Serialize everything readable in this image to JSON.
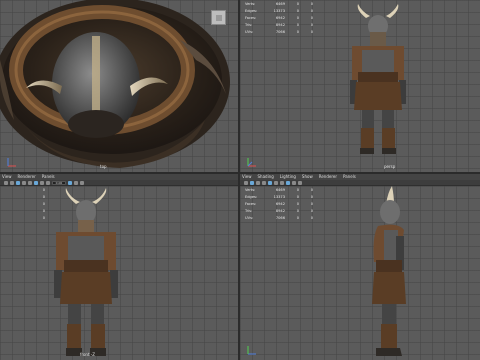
{
  "hud": {
    "rows": [
      {
        "label": "Verts:",
        "value": "6469",
        "a": "0",
        "b": "0"
      },
      {
        "label": "Edges:",
        "value": "13373",
        "a": "0",
        "b": "0"
      },
      {
        "label": "Faces:",
        "value": "6942",
        "a": "0",
        "b": "0"
      },
      {
        "label": "Tris:",
        "value": "8942",
        "a": "0",
        "b": "0"
      },
      {
        "label": "UVs:",
        "value": "7066",
        "a": "0",
        "b": "0"
      }
    ]
  },
  "viewports": {
    "top": {
      "camera": "top"
    },
    "persp": {
      "camera": "persp"
    },
    "front": {
      "camera": "front -Z"
    },
    "side": {
      "camera": ""
    }
  },
  "menu_left": [
    "View",
    "Renderer",
    "Panels"
  ],
  "menu_right": [
    "View",
    "Shading",
    "Lighting",
    "Show",
    "Renderer",
    "Panels"
  ],
  "toolbar_field": "0.00",
  "icons": {
    "axis": "axis-gizmo-icon",
    "swatch": "color-swatch-icon"
  }
}
